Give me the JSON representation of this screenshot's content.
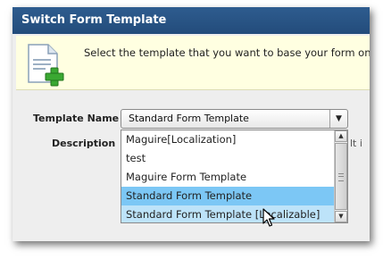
{
  "dialog": {
    "title": "Switch Form Template",
    "banner_text": "Select the template that you want to base your form on, th",
    "template_label": "Template Name",
    "description_label": "Description",
    "description_value_partial": "lt i",
    "selected_template": "Standard Form Template",
    "dropdown_options": [
      "Maguire[Localization]",
      "test",
      "Maguire Form Template",
      "Standard Form Template",
      "Standard Form Template [Localizable]"
    ]
  },
  "colors": {
    "titlebar": "#234c7b",
    "banner_bg": "#ffffe1",
    "selected_option": "#7cc7f5",
    "hover_option": "#bde3f9"
  },
  "icons": [
    "document-add-icon",
    "dropdown-arrow-icon",
    "scroll-up-icon",
    "scroll-down-icon",
    "mouse-cursor-icon"
  ]
}
